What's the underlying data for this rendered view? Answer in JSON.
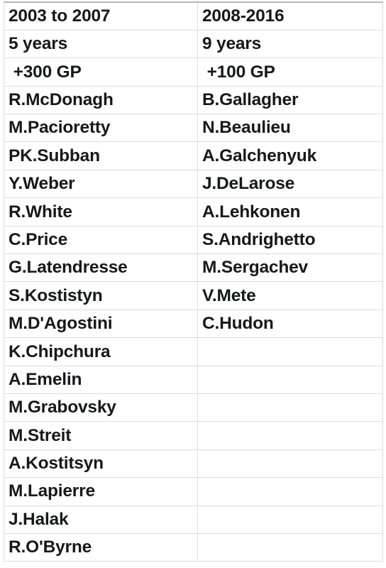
{
  "table": {
    "columns": [
      {
        "key": "left",
        "header": "2003 to 2007"
      },
      {
        "key": "right",
        "header": "2008-2016"
      }
    ],
    "rows": [
      {
        "left": "2003 to 2007",
        "right": "2008-2016"
      },
      {
        "left": "5 years",
        "right": "9 years"
      },
      {
        "left": " +300 GP",
        "right": " +100 GP"
      },
      {
        "left": "R.McDonagh",
        "right": "B.Gallagher"
      },
      {
        "left": "M.Pacioretty",
        "right": "N.Beaulieu"
      },
      {
        "left": "PK.Subban",
        "right": "A.Galchenyuk"
      },
      {
        "left": "Y.Weber",
        "right": "J.DeLarose"
      },
      {
        "left": "R.White",
        "right": "A.Lehkonen"
      },
      {
        "left": "C.Price",
        "right": "S.Andrighetto"
      },
      {
        "left": "G.Latendresse",
        "right": "M.Sergachev"
      },
      {
        "left": "S.Kostistyn",
        "right": "V.Mete"
      },
      {
        "left": "M.D'Agostini",
        "right": "C.Hudon"
      },
      {
        "left": "K.Chipchura",
        "right": ""
      },
      {
        "left": "A.Emelin",
        "right": ""
      },
      {
        "left": "M.Grabovsky",
        "right": ""
      },
      {
        "left": "M.Streit",
        "right": ""
      },
      {
        "left": "A.Kostitsyn",
        "right": ""
      },
      {
        "left": "M.Lapierre",
        "right": ""
      },
      {
        "left": "J.Halak",
        "right": ""
      },
      {
        "left": "R.O'Byrne",
        "right": ""
      }
    ],
    "colors": {
      "background": "#ffffff",
      "grid_line": "#dcdcdc",
      "top_rule": "#b9b9b9",
      "text": "#16181c"
    }
  }
}
